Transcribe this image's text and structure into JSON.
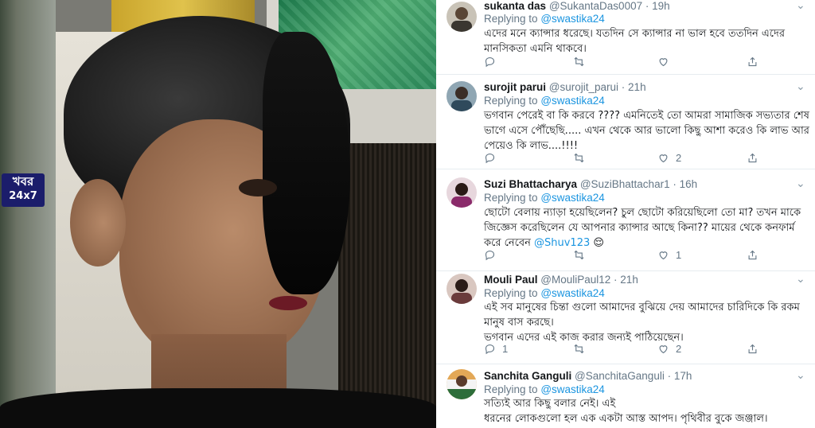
{
  "logo": {
    "line1": "খবর",
    "line2": "24x7"
  },
  "replying_prefix": "Replying to",
  "tweets": [
    {
      "name": "sukanta das",
      "handle": "@SukantaDas0007",
      "time": "19h",
      "replying_to": "@swastika24",
      "lines": [
        "এদের মনে ক্যান্সার ধরেছে। যতদিন সে ক্যান্সার না ভাল হবে ততদিন এদের",
        "মানসিকতা এমনি থাকবে।"
      ],
      "reply_count": "",
      "retweet_count": "",
      "like_count": "",
      "avatar_color": "#3a3630"
    },
    {
      "name": "surojit parui",
      "handle": "@surojit_parui",
      "time": "21h",
      "replying_to": "@swastika24",
      "lines": [
        "ভগবান পেরেই বা কি করবে ???? এমনিতেই তো আমরা সামাজিক সভ্যতার শেষ",
        "ভাগে এসে পৌঁছেছি..... এখন থেকে আর ভালো কিছু আশা করেও কি লাভ আর",
        "পেয়েও কি লাভ....!!!!"
      ],
      "reply_count": "",
      "retweet_count": "",
      "like_count": "2",
      "avatar_color": "#2f4a5c"
    },
    {
      "name": "Suzi Bhattacharya",
      "handle": "@SuziBhattachar1",
      "time": "16h",
      "replying_to": "@swastika24",
      "lines": [
        "ছোটো বেলায় ন্যাড়া হয়েছিলেন? চুল ছোটো করিয়েছিলো তো মা? তখন মাকে",
        "জিজ্ঞেস করেছিলেন যে আপনার ক্যান্সার আছে কিনা?? মায়ের থেকে কনফার্ম"
      ],
      "line3_text": "করে নেবেন",
      "line3_mention": "@Shuv123",
      "line3_emoji": "😌",
      "reply_count": "",
      "retweet_count": "",
      "like_count": "1",
      "avatar_color": "#8a2a6a"
    },
    {
      "name": "Mouli Paul",
      "handle": "@MouliPaul12",
      "time": "21h",
      "replying_to": "@swastika24",
      "lines": [
        "এই সব মানুষের চিন্তা গুলো আমাদের বুঝিয়ে দেয় আমাদের চারিদিকে কি রকম",
        "মানুষ বাস করছে।",
        "ভগবান এদের এই কাজ করার জন্যই পাঠিয়েছেন।"
      ],
      "reply_count": "1",
      "retweet_count": "",
      "like_count": "2",
      "avatar_color": "#6a3b3b"
    },
    {
      "name": "Sanchita Ganguli",
      "handle": "@SanchitaGanguli",
      "time": "17h",
      "replying_to": "@swastika24",
      "lines": [
        "সত্যিই আর কিছু বলার নেই। এই",
        "ধরনের লোকগুলো হল এক একটা আস্ত আপদ। পৃথিবীর বুকে জঞ্জাল।"
      ],
      "reply_count": "",
      "retweet_count": "",
      "like_count": "",
      "avatar_color": "#2e6e3a"
    }
  ],
  "colors": {
    "link": "#1b95e0",
    "muted": "#657786",
    "text": "#14171a",
    "logo_bg": "#1b1d6b"
  },
  "icons": [
    "reply-icon",
    "retweet-icon",
    "like-icon",
    "share-icon",
    "chevron-down-icon"
  ]
}
